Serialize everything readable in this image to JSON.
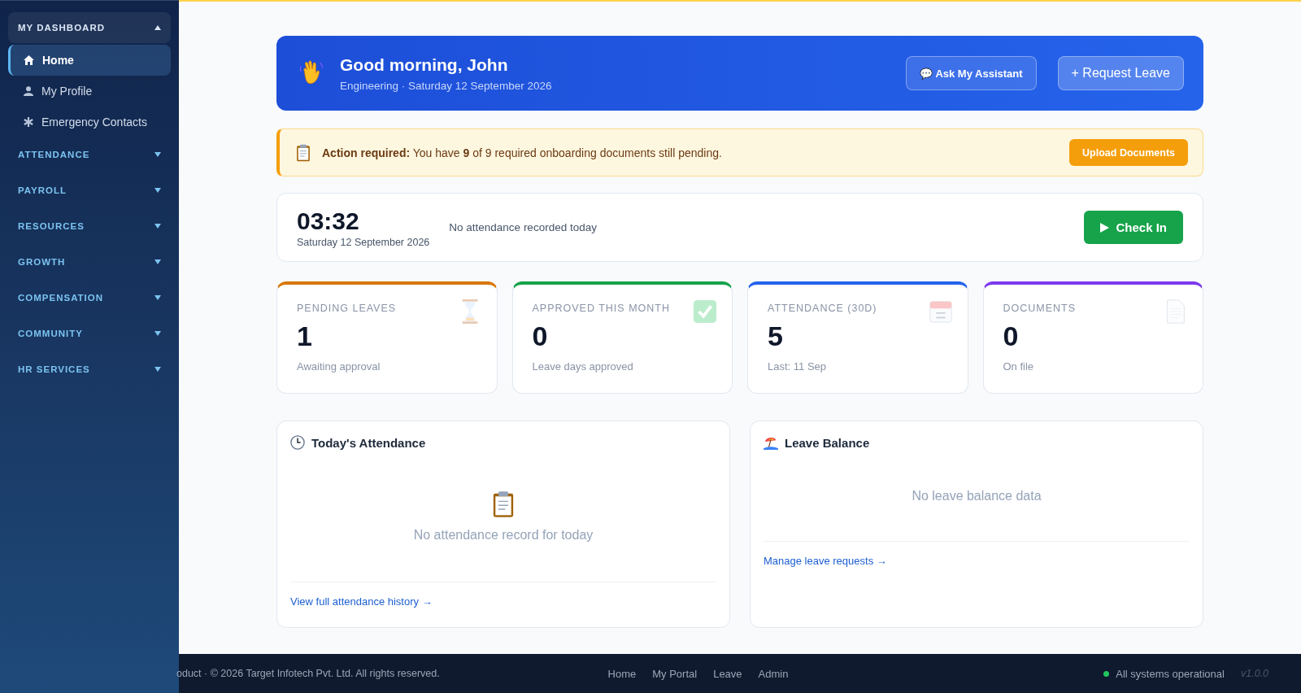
{
  "sidebar": {
    "groups": [
      {
        "label": "MY DASHBOARD",
        "expanded": true,
        "children": [
          {
            "label": "Home",
            "selected": true
          },
          {
            "label": "My Profile",
            "selected": false
          },
          {
            "label": "Emergency Contacts",
            "selected": false
          }
        ]
      },
      {
        "label": "ATTENDANCE",
        "expanded": false
      },
      {
        "label": "PAYROLL",
        "expanded": false
      },
      {
        "label": "RESOURCES",
        "expanded": false
      },
      {
        "label": "GROWTH",
        "expanded": false
      },
      {
        "label": "COMPENSATION",
        "expanded": false
      },
      {
        "label": "COMMUNITY",
        "expanded": false
      },
      {
        "label": "HR SERVICES",
        "expanded": false
      }
    ]
  },
  "hero": {
    "greeting": "Good morning, John",
    "subtitle": "Engineering · Saturday 12 September 2026",
    "buttons": [
      {
        "label": "💬 Ask My Assistant",
        "kind": "secondary"
      },
      {
        "label": "+ Request Leave",
        "kind": "primary"
      }
    ]
  },
  "alert": {
    "text": "**Action required:** You have **9** of 9 required onboarding documents still pending.",
    "button": "Upload Documents"
  },
  "clock": {
    "time": "03:32",
    "date": "Saturday 12 September 2026",
    "status": "No attendance recorded today",
    "button": "Check In"
  },
  "stats": [
    {
      "label": "PENDING LEAVES",
      "value": "1",
      "note": "Awaiting approval",
      "color": "#d97706"
    },
    {
      "label": "APPROVED THIS MONTH",
      "value": "0",
      "note": "Leave days approved",
      "color": "#16a34a"
    },
    {
      "label": "ATTENDANCE (30D)",
      "value": "5",
      "note": "Last: 11 Sep",
      "color": "#2563eb"
    },
    {
      "label": "DOCUMENTS",
      "value": "0",
      "note": "On file",
      "color": "#7c3aed"
    }
  ],
  "panels": [
    {
      "title": "Today's Attendance",
      "empty": "No attendance record for today",
      "link": "View full attendance history →"
    },
    {
      "title": "Leave Balance",
      "empty": "No leave balance data",
      "link": "Manage leave requests →"
    }
  ],
  "footer": {
    "copyright": "oduct · © 2026 Target Infotech Pvt. Ltd. All rights reserved.",
    "links": [
      "Home",
      "My Portal",
      "Leave",
      "Admin"
    ],
    "status": "All systems operational",
    "version": "v1.0.0"
  }
}
